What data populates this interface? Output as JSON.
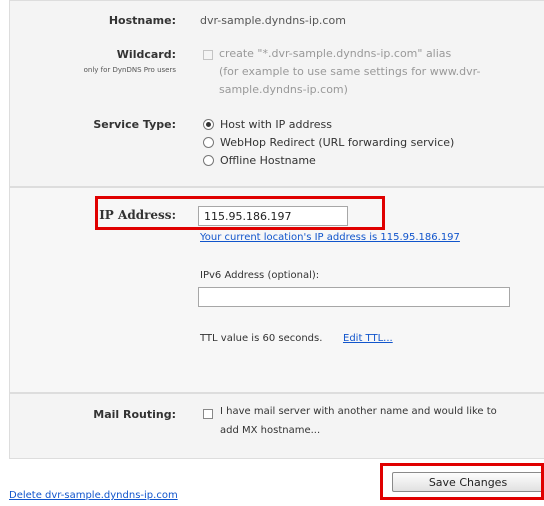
{
  "hostname": {
    "label": "Hostname:",
    "value": "dvr-sample.dyndns-ip.com"
  },
  "wildcard": {
    "label": "Wildcard:",
    "note": "only for DynDNS Pro users",
    "checkbox_text": "create \"*.dvr-sample.dyndns-ip.com\" alias",
    "hint_lines": [
      "(for example to use same settings for www.dvr-",
      "sample.dyndns-ip.com)"
    ]
  },
  "service_type": {
    "label": "Service Type:",
    "options": [
      {
        "label": "Host with IP address",
        "checked": true
      },
      {
        "label": "WebHop Redirect (URL forwarding service)",
        "checked": false
      },
      {
        "label": "Offline Hostname",
        "checked": false
      }
    ]
  },
  "ip_address": {
    "label": "IP Address:",
    "value": "115.95.186.197",
    "current_location_link": "Your current location's IP address is 115.95.186.197"
  },
  "ipv6": {
    "label": "IPv6 Address (optional):",
    "value": ""
  },
  "ttl": {
    "text": "TTL value is 60 seconds.",
    "edit_link": "Edit TTL..."
  },
  "mail_routing": {
    "label": "Mail Routing:",
    "checkbox_lines": [
      "I have mail server with another name and would like to",
      "add MX hostname..."
    ]
  },
  "actions": {
    "save_label": "Save Changes",
    "delete_link": "Delete dvr-sample.dyndns-ip.com"
  },
  "colors": {
    "highlight": "#e00000",
    "link": "#1155cc"
  }
}
